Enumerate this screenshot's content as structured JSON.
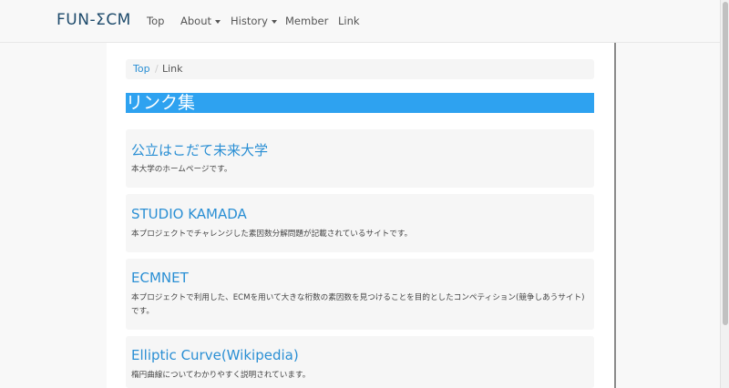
{
  "navbar": {
    "brand": "FUN-ΣCM",
    "items": [
      {
        "label": "Top"
      },
      {
        "label": "About"
      },
      {
        "label": "History"
      },
      {
        "label": "Member"
      },
      {
        "label": "Link"
      }
    ]
  },
  "breadcrumb": {
    "home": "Top",
    "separator": "/",
    "current": "Link"
  },
  "main": {
    "title": "リンク集",
    "links": [
      {
        "title": "公立はこだて未来大学",
        "description": "本大学のホームページです。"
      },
      {
        "title": "STUDIO KAMADA",
        "description": "本プロジェクトでチャレンジした素因数分解問題が記載されているサイトです。"
      },
      {
        "title": "ECMNET",
        "description": "本プロジェクトで利用した、ECMを用いて大きな桁数の素因数を見つけることを目的としたコンペティション(競争しあうサイト)です。"
      },
      {
        "title": "Elliptic Curve(Wikipedia)",
        "description": "楕円曲線についてわかりやすく説明されています。"
      }
    ]
  },
  "colors": {
    "link": "#2a8fd4",
    "title_bar": "#2ea2f0",
    "brand": "#1d4a6b"
  }
}
